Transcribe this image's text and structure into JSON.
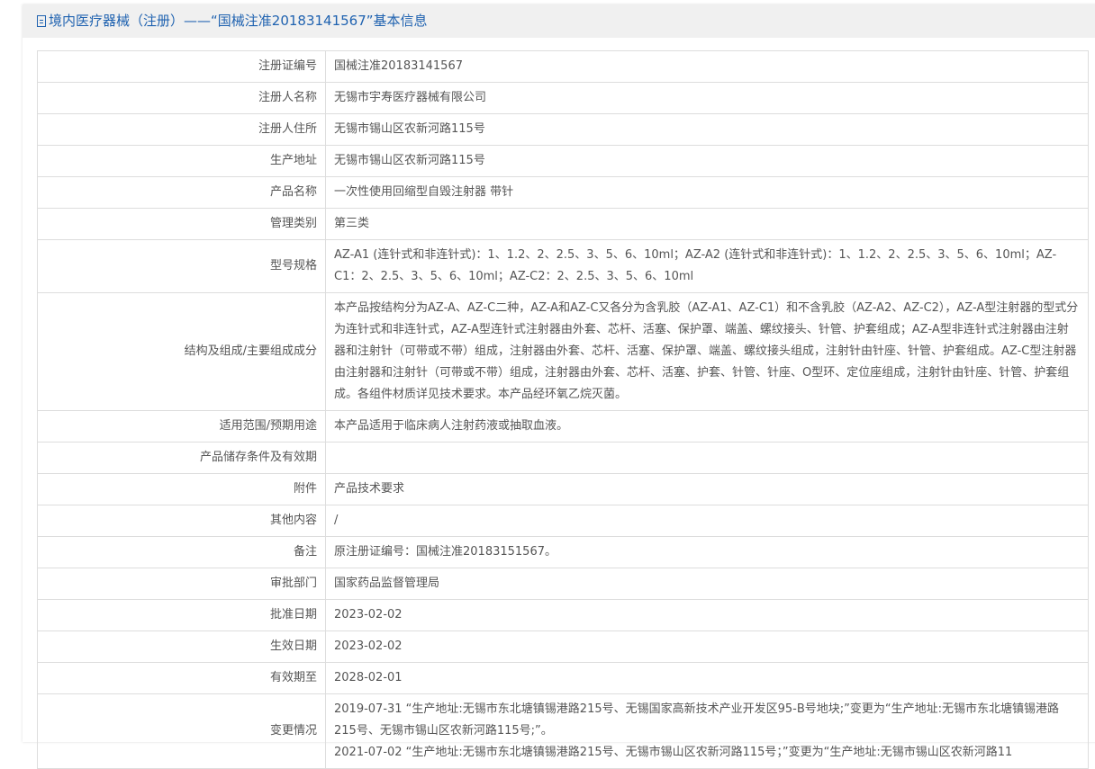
{
  "header": {
    "title": "境内医疗器械（注册）——“国械注准20183141567”基本信息"
  },
  "rows": [
    {
      "label": "注册证编号",
      "value": "国械注准20183141567"
    },
    {
      "label": "注册人名称",
      "value": "无锡市宇寿医疗器械有限公司"
    },
    {
      "label": "注册人住所",
      "value": "无锡市锡山区农新河路115号"
    },
    {
      "label": "生产地址",
      "value": "无锡市锡山区农新河路115号"
    },
    {
      "label": "产品名称",
      "value": "一次性使用回缩型自毁注射器 带针"
    },
    {
      "label": "管理类别",
      "value": "第三类"
    },
    {
      "label": "型号规格",
      "value": "AZ-A1 (连针式和非连针式)：1、1.2、2、2.5、3、5、6、10ml；AZ-A2 (连针式和非连针式)：1、1.2、2、2.5、3、5、6、10ml；AZ-C1：2、2.5、3、5、6、10ml；AZ-C2：2、2.5、3、5、6、10ml"
    },
    {
      "label": "结构及组成/主要组成成分",
      "value": "本产品按结构分为AZ-A、AZ-C二种，AZ-A和AZ-C又各分为含乳胶（AZ-A1、AZ-C1）和不含乳胶（AZ-A2、AZ-C2），AZ-A型注射器的型式分为连针式和非连针式，AZ-A型连针式注射器由外套、芯杆、活塞、保护罩、端盖、螺纹接头、针管、护套组成；AZ-A型非连针式注射器由注射器和注射针（可带或不带）组成，注射器由外套、芯杆、活塞、保护罩、端盖、螺纹接头组成，注射针由针座、针管、护套组成。AZ-C型注射器由注射器和注射针（可带或不带）组成，注射器由外套、芯杆、活塞、护套、针管、针座、O型环、定位座组成，注射针由针座、针管、护套组成。各组件材质详见技术要求。本产品经环氧乙烷灭菌。"
    },
    {
      "label": "适用范围/预期用途",
      "value": "本产品适用于临床病人注射药液或抽取血液。"
    },
    {
      "label": "产品储存条件及有效期",
      "value": ""
    },
    {
      "label": "附件",
      "value": "产品技术要求"
    },
    {
      "label": "其他内容",
      "value": "/"
    },
    {
      "label": "备注",
      "value": "原注册证编号：国械注准20183151567。"
    },
    {
      "label": "审批部门",
      "value": "国家药品监督管理局"
    },
    {
      "label": "批准日期",
      "value": "2023-02-02"
    },
    {
      "label": "生效日期",
      "value": "2023-02-02"
    },
    {
      "label": "有效期至",
      "value": "2028-02-01"
    }
  ],
  "changes": {
    "label": "变更情况",
    "entries": [
      "2019-07-31 “生产地址:无锡市东北塘镇锡港路215号、无锡国家高新技术产业开发区95-B号地块;”变更为“生产地址:无锡市东北塘镇锡港路215号、无锡市锡山区农新河路115号;”。",
      "2021-07-02 “生产地址:无锡市东北塘镇锡港路215号、无锡市锡山区农新河路115号；”变更为“生产地址:无锡市锡山区农新河路11"
    ]
  }
}
